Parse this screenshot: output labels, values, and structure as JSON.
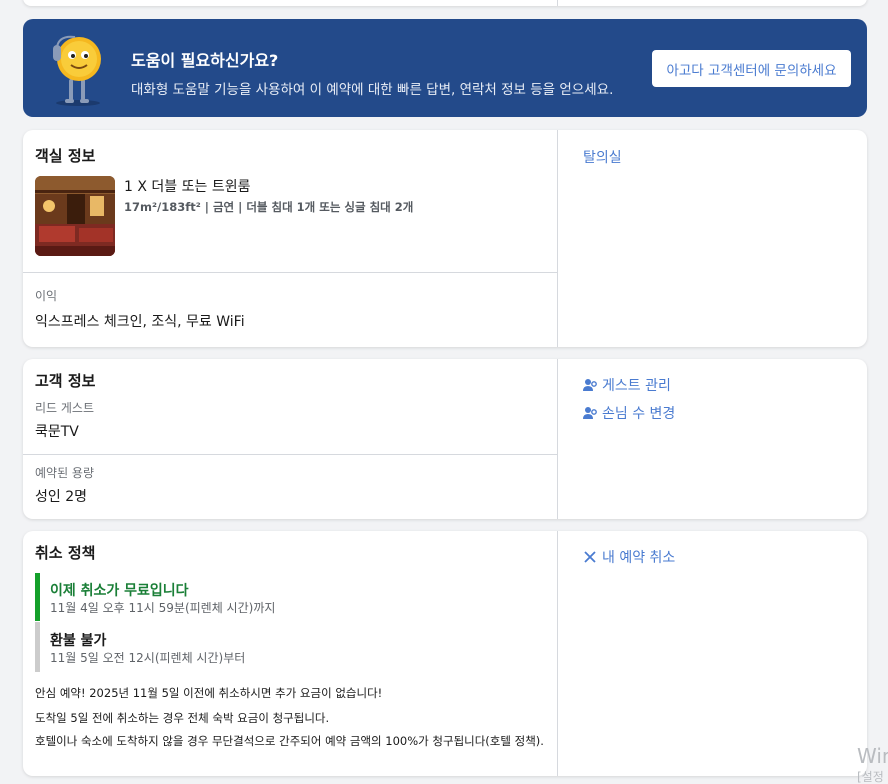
{
  "help": {
    "title": "도움이 필요하신가요?",
    "description": "대화형 도움말 기능을 사용하여 이 예약에 대한 빠른 답변, 연락처 정보 등을 얻으세요.",
    "button_label": "아고다 고객센터에 문의하세요"
  },
  "room": {
    "section_title": "객실 정보",
    "name": "1 X 더블 또는 트윈룸",
    "details": "17m²/183ft² | 금연 | 더블 침대 1개 또는 싱글 침대 2개",
    "benefits_label": "이익",
    "benefits_value": "익스프레스 체크인, 조식, 무료 WiFi",
    "side_link": "탈의실"
  },
  "guest": {
    "section_title": "고객 정보",
    "lead_label": "리드 게스트",
    "lead_value": "쿡문TV",
    "capacity_label": "예약된 용량",
    "capacity_value": "성인 2명",
    "manage_link": "게스트 관리",
    "change_count_link": "손님 수 변경"
  },
  "cancel": {
    "section_title": "취소 정책",
    "free_title": "이제 취소가 무료입니다",
    "free_sub": "11월 4일 오후 11시 59분(피렌체 시간)까지",
    "nonrefund_title": "환불 불가",
    "nonrefund_sub": "11월 5일 오전 12시(피렌체 시간)부터",
    "note1": "안심 예약! 2025년 11월 5일 이전에 취소하시면 추가 요금이 없습니다!",
    "note2": "도착일 5일 전에 취소하는 경우 전체 숙박 요금이 청구됩니다.",
    "note3": "호텔이나 숙소에 도착하지 않을 경우 무단결석으로 간주되어 예약 금액의 100%가 청구됩니다(호텔 정책).",
    "cancel_link": "내 예약 취소"
  },
  "watermark": {
    "line1": "Win",
    "line2": "[설정"
  },
  "colors": {
    "banner_bg": "#234a8a",
    "link": "#4a7bd0",
    "free_green": "#1a7f37",
    "bar_green": "#14a02a",
    "bar_gray": "#cccccc"
  }
}
